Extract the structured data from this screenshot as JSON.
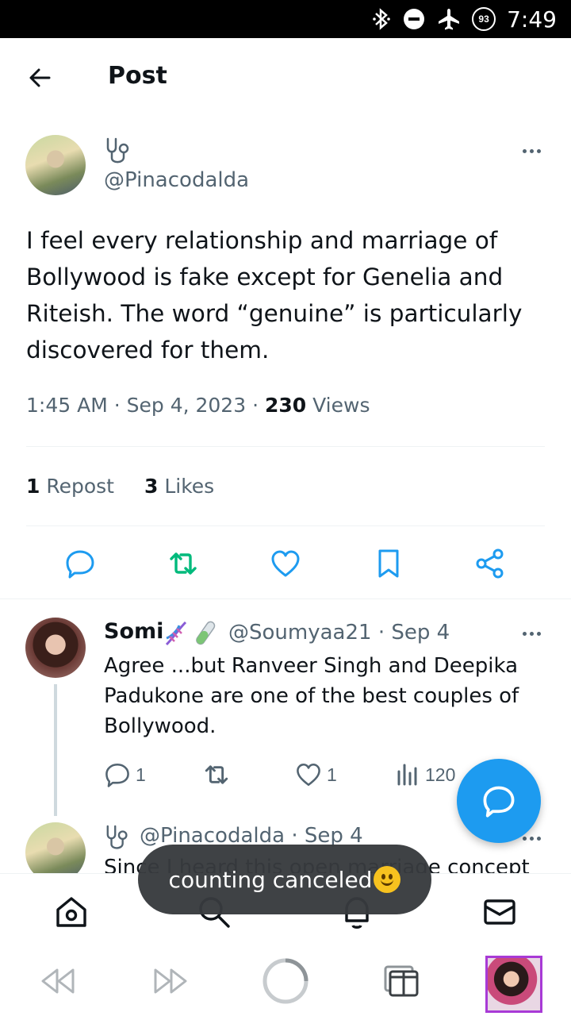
{
  "status_bar": {
    "battery": "93",
    "time": "7:49"
  },
  "header": {
    "title": "Post"
  },
  "post": {
    "handle": "@Pinacodalda",
    "text": "I feel every relationship and marriage of Bollywood is fake except for Genelia and Riteish. The word “genuine” is particularly discovered for them.",
    "time": "1:45 AM",
    "date": "Sep 4, 2023",
    "views_count": "230",
    "views_label": "Views",
    "reposts_count": "1",
    "reposts_label": "Repost",
    "likes_count": "3",
    "likes_label": "Likes"
  },
  "reply": {
    "name": "Somi",
    "handle": "@Soumyaa21",
    "date": "Sep 4",
    "text": "Agree ...but Ranveer Singh and Deepika Padukone are one of the best couples of Bollywood.",
    "reply_count": "1",
    "like_count": "1",
    "views_count": "120"
  },
  "reply2": {
    "handle": "@Pinacodalda",
    "date": "Sep 4",
    "text": "Since I heard this open marriage concept"
  },
  "toast": {
    "text": "counting canceled"
  },
  "colors": {
    "accent": "#1d9bf0",
    "repost_green": "#00ba7c",
    "muted": "#536471"
  }
}
